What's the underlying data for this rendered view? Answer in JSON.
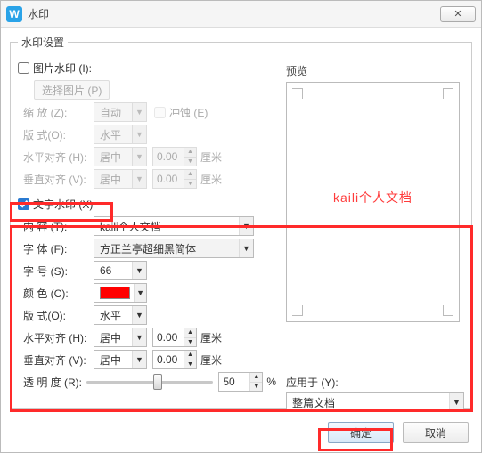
{
  "window": {
    "title": "水印",
    "icon_letter": "W"
  },
  "group_legend": "水印设置",
  "imgwm": {
    "checkbox_label": "图片水印 (I):",
    "checked": false,
    "choose_btn": "选择图片 (P)",
    "zoom_label": "缩 放 (Z):",
    "zoom_value": "自动",
    "erode_label": "冲蚀 (E)",
    "format_label": "版 式(O):",
    "format_value": "水平",
    "halign_label": "水平对齐 (H):",
    "halign_value": "居中",
    "h_offset": "0.00",
    "h_unit": "厘米",
    "valign_label": "垂直对齐 (V):",
    "valign_value": "居中",
    "v_offset": "0.00",
    "v_unit": "厘米"
  },
  "txtwm": {
    "checkbox_label": "文字水印 (X)",
    "checked": true,
    "content_label": "内 容 (T):",
    "content_value": "kaili个人文档",
    "font_label": "字 体 (F):",
    "font_value": "方正兰亭超细黑简体",
    "size_label": "字 号 (S):",
    "size_value": "66",
    "color_label": "颜 色 (C):",
    "color_hex": "#ff0000",
    "format_label": "版 式(O):",
    "format_value": "水平",
    "halign_label": "水平对齐 (H):",
    "halign_value": "居中",
    "h_offset": "0.00",
    "h_unit": "厘米",
    "valign_label": "垂直对齐 (V):",
    "valign_value": "居中",
    "v_offset": "0.00",
    "v_unit": "厘米",
    "opacity_label": "透 明 度 (R):",
    "opacity_value": "50",
    "opacity_unit": "%",
    "opacity_slider_pct": 50
  },
  "preview": {
    "title": "预览",
    "text": "kaili个人文档"
  },
  "apply": {
    "label": "应用于 (Y):",
    "value": "整篇文档"
  },
  "footer": {
    "ok": "确定",
    "cancel": "取消"
  }
}
